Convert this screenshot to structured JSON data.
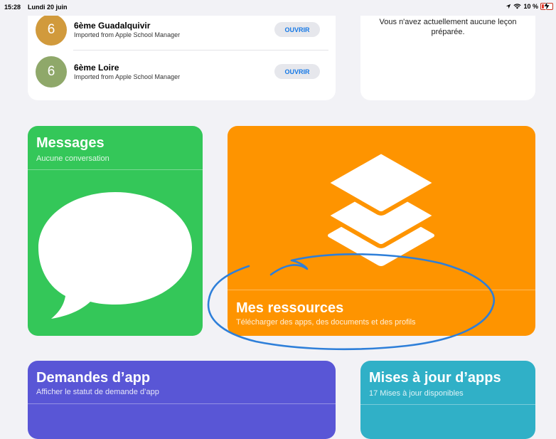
{
  "status_bar": {
    "time": "15:28",
    "date": "Lundi 20 juin",
    "battery": "10 %",
    "icons": [
      "location-icon",
      "wifi-icon",
      "battery-charging-icon"
    ]
  },
  "classes": [
    {
      "avatar_text": "6",
      "avatar_color": "#d19a3c",
      "name": "6ème Guadalquivir",
      "source": "Imported from Apple School Manager",
      "button": "OUVRIR"
    },
    {
      "avatar_text": "6",
      "avatar_color": "#8fa86a",
      "name": "6ème Loire",
      "source": "Imported from Apple School Manager",
      "button": "OUVRIR"
    }
  ],
  "lessons": {
    "empty_text": "Vous n'avez actuellement aucune leçon préparée."
  },
  "tiles": {
    "messages": {
      "title": "Messages",
      "subtitle": "Aucune conversation",
      "color": "#34c759",
      "icon": "speech-bubble-icon"
    },
    "resources": {
      "title": "Mes ressources",
      "subtitle": "Télécharger des apps, des documents et des profils",
      "color": "#fe9400",
      "icon": "stacked-layers-icon"
    },
    "app_requests": {
      "title": "Demandes d’app",
      "subtitle": "Afficher le statut de demande d’app",
      "color": "#5956d6"
    },
    "app_updates": {
      "title": "Mises à jour d’apps",
      "subtitle": "17 Mises à jour disponibles",
      "color": "#30b0c7"
    }
  },
  "annotation_color": "#2e7fd9"
}
